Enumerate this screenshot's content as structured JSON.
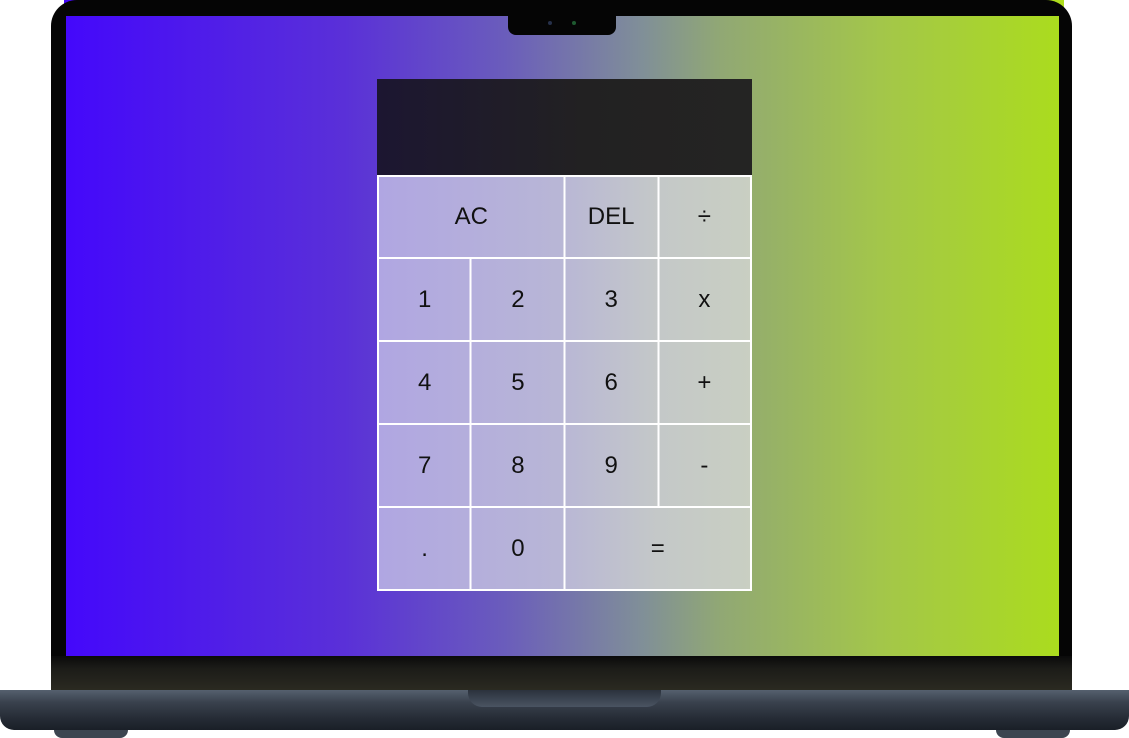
{
  "calculator": {
    "display": {
      "previous": "",
      "current": ""
    },
    "keys": [
      "AC",
      "DEL",
      "÷",
      "1",
      "2",
      "3",
      "x",
      "4",
      "5",
      "6",
      "+",
      "7",
      "8",
      "9",
      "-",
      ".",
      "0",
      "="
    ]
  },
  "colors": {
    "screen_gradient_start": "#4408fb",
    "screen_gradient_end": "#abdc1e",
    "display_bg": "#222122",
    "keypad_bg": "#b8b6d6"
  }
}
